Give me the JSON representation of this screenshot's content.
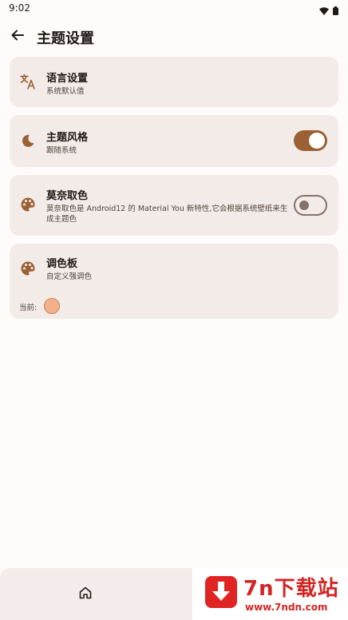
{
  "status_bar": {
    "time": "9:02",
    "icons": [
      "wifi-icon",
      "battery-icon"
    ]
  },
  "app_bar": {
    "back_icon": "arrow-back-icon",
    "title": "主题设置"
  },
  "settings": {
    "language": {
      "icon": "translate-icon",
      "title": "语言设置",
      "subtitle": "系统默认值"
    },
    "theme_style": {
      "icon": "moon-icon",
      "title": "主题风格",
      "subtitle": "跟随系统",
      "toggle_on": true
    },
    "monet": {
      "icon": "palette-icon",
      "title": "莫奈取色",
      "subtitle": "莫奈取色是 Android12 的 Material You 新特性,它会根据系统壁纸来生成主题色",
      "toggle_on": false
    },
    "palette": {
      "icon": "palette-icon",
      "title": "调色板",
      "subtitle": "自定义强调色",
      "current_label": "当前:",
      "current_color": "#f5b08a"
    }
  },
  "bottom_nav": {
    "home_icon": "home-icon"
  },
  "watermark": {
    "title": "7n下载站",
    "url": "www.7ndn.com"
  },
  "colors": {
    "accent": "#9b6134",
    "card_bg": "#f2ebe8",
    "background": "#fffbfa",
    "watermark_red": "#d42424"
  }
}
